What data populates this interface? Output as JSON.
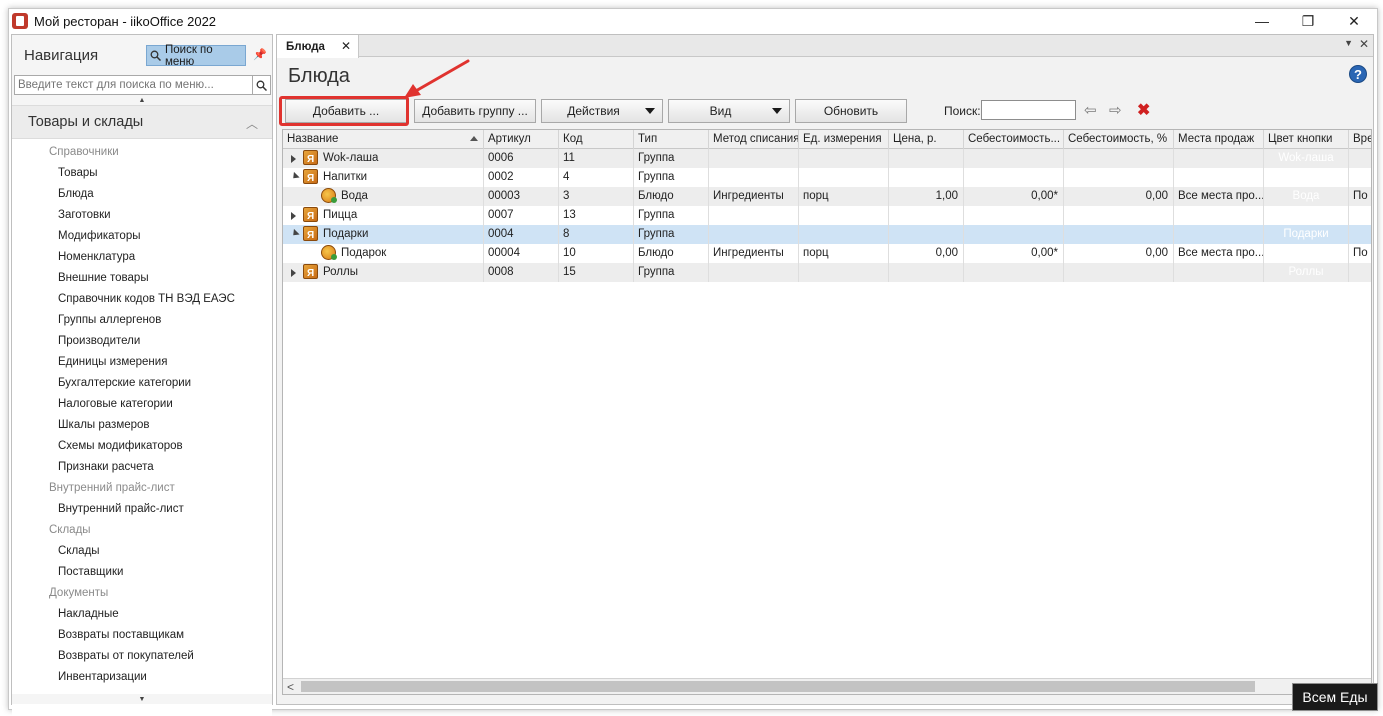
{
  "window": {
    "title": "Мой ресторан - iikoOffice 2022",
    "minimize": "—",
    "restore": "❐",
    "close": "✕"
  },
  "navigation": {
    "title": "Навигация",
    "menu_search_button": "Поиск по меню",
    "search_placeholder": "Введите текст для поиска по меню...",
    "section_title": "Товары и склады",
    "items": [
      {
        "kind": "cat",
        "label": "Справочники"
      },
      {
        "kind": "item",
        "label": "Товары"
      },
      {
        "kind": "item",
        "label": "Блюда"
      },
      {
        "kind": "item",
        "label": "Заготовки"
      },
      {
        "kind": "item",
        "label": "Модификаторы"
      },
      {
        "kind": "item",
        "label": "Номенклатура"
      },
      {
        "kind": "item",
        "label": "Внешние товары"
      },
      {
        "kind": "item",
        "label": "Справочник кодов ТН ВЭД ЕАЭС"
      },
      {
        "kind": "item",
        "label": "Группы аллергенов"
      },
      {
        "kind": "item",
        "label": "Производители"
      },
      {
        "kind": "item",
        "label": "Единицы измерения"
      },
      {
        "kind": "item",
        "label": "Бухгалтерские категории"
      },
      {
        "kind": "item",
        "label": "Налоговые категории"
      },
      {
        "kind": "item",
        "label": "Шкалы размеров"
      },
      {
        "kind": "item",
        "label": "Схемы модификаторов"
      },
      {
        "kind": "item",
        "label": "Признаки расчета"
      },
      {
        "kind": "cat",
        "label": "Внутренний прайс-лист"
      },
      {
        "kind": "item",
        "label": "Внутренний прайс-лист"
      },
      {
        "kind": "cat",
        "label": "Склады"
      },
      {
        "kind": "item",
        "label": "Склады"
      },
      {
        "kind": "item",
        "label": "Поставщики"
      },
      {
        "kind": "cat",
        "label": "Документы"
      },
      {
        "kind": "item",
        "label": "Накладные"
      },
      {
        "kind": "item",
        "label": "Возвраты поставщикам"
      },
      {
        "kind": "item",
        "label": "Возвраты от покупателей"
      },
      {
        "kind": "item",
        "label": "Инвентаризации"
      }
    ]
  },
  "tab": {
    "label": "Блюда",
    "close": "✕"
  },
  "page": {
    "title": "Блюда",
    "help": "?"
  },
  "toolbar": {
    "add": "Добавить ...",
    "add_group": "Добавить группу ...",
    "actions": "Действия",
    "view": "Вид",
    "refresh": "Обновить",
    "search_label": "Поиск:",
    "search_value": ""
  },
  "grid": {
    "columns": [
      "Название",
      "Артикул",
      "Код",
      "Тип",
      "Метод списания",
      "Ед. измерения",
      "Цена, р.",
      "Себестоимость...",
      "Себестоимость, %",
      "Места продаж",
      "Цвет кнопки",
      "Врем"
    ],
    "rows": [
      {
        "level": 0,
        "expand": "closed",
        "icon": "group",
        "name": "Wok-лаша",
        "article": "0006",
        "code": "11",
        "type": "Группа",
        "method": "",
        "unit": "",
        "price": "",
        "cost": "",
        "cost_pct": "",
        "places": "",
        "btn_color": "Wok-лаша",
        "time": ""
      },
      {
        "level": 0,
        "expand": "open",
        "icon": "group",
        "name": "Напитки",
        "article": "0002",
        "code": "4",
        "type": "Группа",
        "method": "",
        "unit": "",
        "price": "",
        "cost": "",
        "cost_pct": "",
        "places": "",
        "btn_color": "",
        "time": ""
      },
      {
        "level": 1,
        "expand": "none",
        "icon": "dish",
        "name": "Вода",
        "article": "00003",
        "code": "3",
        "type": "Блюдо",
        "method": "Ингредиенты",
        "unit": "порц",
        "price": "1,00",
        "cost": "0,00*",
        "cost_pct": "0,00",
        "places": "Все места про...",
        "btn_color": "Вода",
        "time": "По у"
      },
      {
        "level": 0,
        "expand": "closed",
        "icon": "group",
        "name": "Пицца",
        "article": "0007",
        "code": "13",
        "type": "Группа",
        "method": "",
        "unit": "",
        "price": "",
        "cost": "",
        "cost_pct": "",
        "places": "",
        "btn_color": "",
        "time": ""
      },
      {
        "level": 0,
        "expand": "open",
        "icon": "group",
        "name": "Подарки",
        "article": "0004",
        "code": "8",
        "type": "Группа",
        "method": "",
        "unit": "",
        "price": "",
        "cost": "",
        "cost_pct": "",
        "places": "",
        "btn_color": "Подарки",
        "time": ""
      },
      {
        "level": 1,
        "expand": "none",
        "icon": "dish",
        "name": "Подарок",
        "article": "00004",
        "code": "10",
        "type": "Блюдо",
        "method": "Ингредиенты",
        "unit": "порц",
        "price": "0,00",
        "cost": "0,00*",
        "cost_pct": "0,00",
        "places": "Все места про...",
        "btn_color": "",
        "time": "По у"
      },
      {
        "level": 0,
        "expand": "closed",
        "icon": "group",
        "name": "Роллы",
        "article": "0008",
        "code": "15",
        "type": "Группа",
        "method": "",
        "unit": "",
        "price": "",
        "cost": "",
        "cost_pct": "",
        "places": "",
        "btn_color": "Роллы",
        "time": ""
      }
    ],
    "selected_row": 4
  },
  "watermark": "Всем Еды",
  "colors": {
    "accent_red": "#e0332f",
    "selection": "#cfe3f5",
    "help_blue": "#2a66b4"
  }
}
